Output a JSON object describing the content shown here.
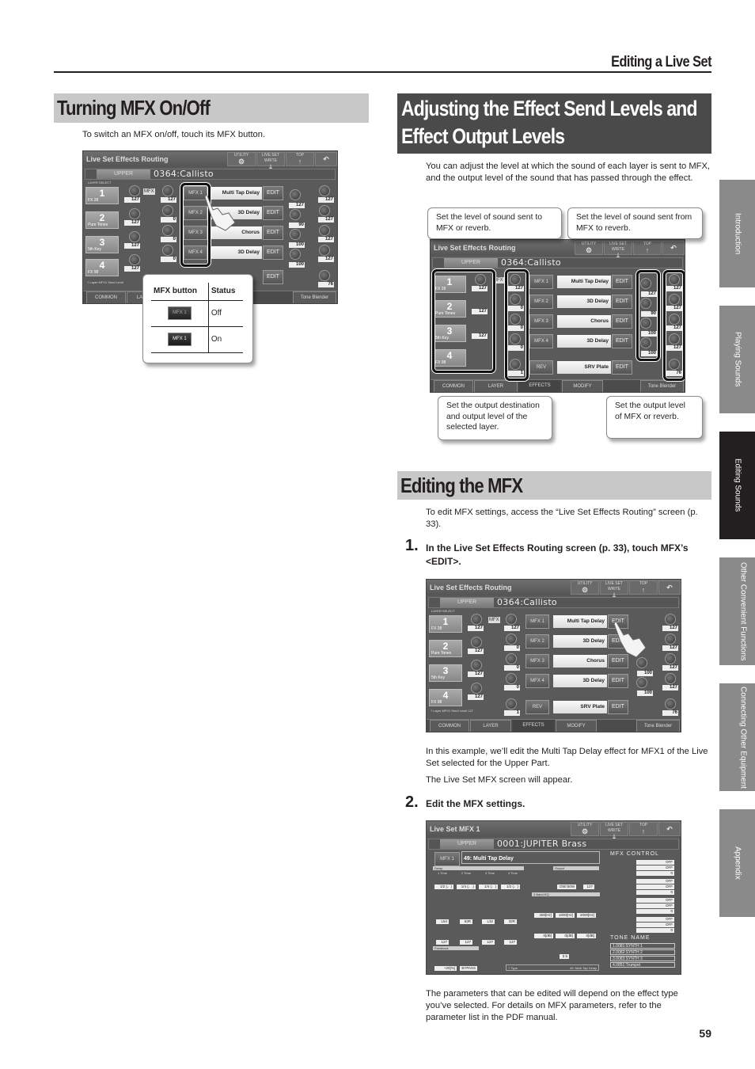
{
  "header": {
    "running_head": "Editing a Live Set",
    "page_number": "59"
  },
  "side_tabs": [
    {
      "label": "Introduction",
      "active": false
    },
    {
      "label": "Playing Sounds",
      "active": false
    },
    {
      "label": "Editing Sounds",
      "active": true
    },
    {
      "label": "Other Convenient Functions",
      "active": false
    },
    {
      "label": "Connecting Other Equipment",
      "active": false
    },
    {
      "label": "Appendix",
      "active": false
    }
  ],
  "section_mfx_onoff": {
    "title": "Turning MFX On/Off",
    "intro": "To switch an MFX on/off, touch its MFX button.",
    "table": {
      "headers": [
        "MFX button",
        "Status"
      ],
      "rows": [
        {
          "button_label": "MFX 1",
          "status": "Off"
        },
        {
          "button_label": "MFX 1",
          "status": "On"
        }
      ]
    }
  },
  "section_levels": {
    "title_line1": "Adjusting the Effect Send Levels and",
    "title_line2": "Effect Output Levels",
    "intro": "You can adjust the level at which the sound of each layer is sent to MFX, and the output level of the sound that has passed through the effect.",
    "callouts": {
      "send_to_mfx": "Set the level of sound sent to MFX or reverb.",
      "mfx_to_reverb": "Set the level of sound sent from MFX to reverb.",
      "layer_output": "Set the output destination and output level of the selected layer.",
      "mfx_output": "Set the output level of MFX or reverb."
    }
  },
  "section_edit_mfx": {
    "title": "Editing the MFX",
    "intro": "To edit MFX settings, access the “Live Set Effects Routing” screen (p. 33).",
    "steps": [
      {
        "number": "1.",
        "text": "In the Live Set Effects Routing screen (p. 33), touch MFX’s <EDIT>."
      },
      {
        "number": "2.",
        "text": "Edit the MFX settings."
      }
    ],
    "example_note": "In this example, we’ll edit the Multi Tap Delay effect for MFX1 of the Live Set selected for the Upper Part.",
    "result_note": "The Live Set MFX screen will appear.",
    "closing": "The parameters that can be edited will depend on the effect type you’ve selected. For details on MFX parameters, refer to the parameter list in the PDF manual."
  },
  "routing_screen": {
    "title": "Live Set Effects Routing",
    "icon_buttons": [
      {
        "label": "UTILITY",
        "icon": "gear-icon",
        "glyph": "⚙"
      },
      {
        "label": "LIVE SET WRITE",
        "icon": "write-icon",
        "glyph": "⤓"
      },
      {
        "label": "TOP",
        "icon": "up-arrow-icon",
        "glyph": "↑"
      },
      {
        "label": "",
        "icon": "back-icon",
        "glyph": "↶"
      }
    ],
    "part": "UPPER",
    "live_set_name": "0364:Callisto",
    "layer_select_label": "LAYER SELECT",
    "mfx_tag": "MFX",
    "layers": [
      {
        "num": "1",
        "name": "FX 28",
        "level": "127"
      },
      {
        "num": "2",
        "name": "Pure Tones",
        "level": "127"
      },
      {
        "num": "3",
        "name": "5th Key",
        "level": "127"
      },
      {
        "num": "4",
        "name": "FX 98",
        "level": "127"
      }
    ],
    "send_levels": [
      "127",
      "0",
      "0",
      "0",
      "1"
    ],
    "effects": [
      {
        "button": "MFX 1",
        "type": "Multi Tap Delay",
        "edit": "EDIT"
      },
      {
        "button": "MFX 2",
        "type": "3D Delay",
        "edit": "EDIT"
      },
      {
        "button": "MFX 3",
        "type": "Chorus",
        "edit": "EDIT"
      },
      {
        "button": "MFX 4",
        "type": "3D Delay",
        "edit": "EDIT"
      },
      {
        "button": "REV",
        "type": "SRV Plate",
        "edit": "EDIT"
      }
    ],
    "reverb_send_levels": [
      "127",
      "90",
      "100",
      "100"
    ],
    "output_levels": [
      "127",
      "127",
      "127",
      "127",
      "76"
    ],
    "help_text": "Layer MFX1 Send Level",
    "help_value": "127",
    "tabs": [
      "COMMON",
      "LAYER",
      "EFFECTS",
      "MODIFY"
    ],
    "active_tab": "EFFECTS",
    "tone_blender": "Tone Blender"
  },
  "mfx_screen": {
    "title": "Live Set MFX 1",
    "part": "UPPER",
    "live_set_name": "0001:JUPITER Brass",
    "mfx_button": "MFX 1",
    "mfx_type_label": "MFX 1 Type",
    "mfx_type": "49: Multi Tap Delay",
    "delay": {
      "label": "Delay",
      "times": [
        {
          "label": "1 Time",
          "value": "1/2 (♩)"
        },
        {
          "label": "2 Time",
          "value": "1/4 (♩.)"
        },
        {
          "label": "3 Time",
          "value": "1/4 (♩)"
        },
        {
          "label": "4 Time",
          "value": "1/2 (♩)"
        }
      ],
      "mode_labels": [
        "msec",
        "NOTE"
      ],
      "pans": [
        {
          "label": "1 Pan",
          "value": "L64"
        },
        {
          "label": "2 Pan",
          "value": "63R"
        },
        {
          "label": "3 Pan",
          "value": "L32"
        },
        {
          "label": "4 Pan",
          "value": "32R"
        }
      ],
      "levels": [
        {
          "label": "1 Level",
          "value": "127"
        },
        {
          "label": "2 Level",
          "value": "127"
        },
        {
          "label": "3 Level",
          "value": "127"
        },
        {
          "label": "4 Level",
          "value": "127"
        }
      ]
    },
    "feedback": {
      "label": "Feedback",
      "delay_fbk": {
        "label": "Delay 1 Fbk",
        "value": "+20[%]"
      },
      "hf_damp": {
        "label": "HF Damp",
        "value": "BYPASS"
      }
    },
    "output": {
      "label": "Output",
      "balance": {
        "label": "Balance",
        "value": "D50:50W"
      },
      "level": {
        "label": "Level",
        "value": "127"
      }
    },
    "eq": {
      "label": "3 Band EQ",
      "freqs": [
        {
          "label": "Low Freq",
          "value": "400[Hz]"
        },
        {
          "label": "Mid Freq",
          "value": "1000[Hz]"
        },
        {
          "label": "High Freq",
          "value": "2000[Hz]"
        }
      ],
      "gains": [
        {
          "label": "Low Gain",
          "value": "0[dB]"
        },
        {
          "label": "Mid Gain",
          "value": "0[dB]"
        },
        {
          "label": "High Gain",
          "value": "0[dB]"
        }
      ],
      "sw_label": "Sw",
      "mid_q": {
        "label": "Mid Q",
        "value": "0.5"
      }
    },
    "help_label": "Type",
    "help_value": "49: Multi Tap Delay",
    "mfx_control": {
      "title": "MFX CONTROL",
      "slots": [
        {
          "num": "1",
          "source": "OFF",
          "destination": "OFF",
          "sens": "0"
        },
        {
          "num": "2",
          "source": "OFF",
          "destination": "OFF",
          "sens": "0"
        },
        {
          "num": "3",
          "source": "OFF",
          "destination": "OFF",
          "sens": "0"
        },
        {
          "num": "4",
          "source": "OFF",
          "destination": "OFF",
          "sens": "0"
        }
      ],
      "row_labels": [
        "Source",
        "Destination",
        "Sens"
      ]
    },
    "tone_name": {
      "title": "TONE NAME",
      "tones": [
        "1.0081:SYNTH 1",
        "2.0082:SYNTH 2",
        "3.0083:SYNTH 3",
        "4.0851:Trumpet"
      ]
    }
  }
}
